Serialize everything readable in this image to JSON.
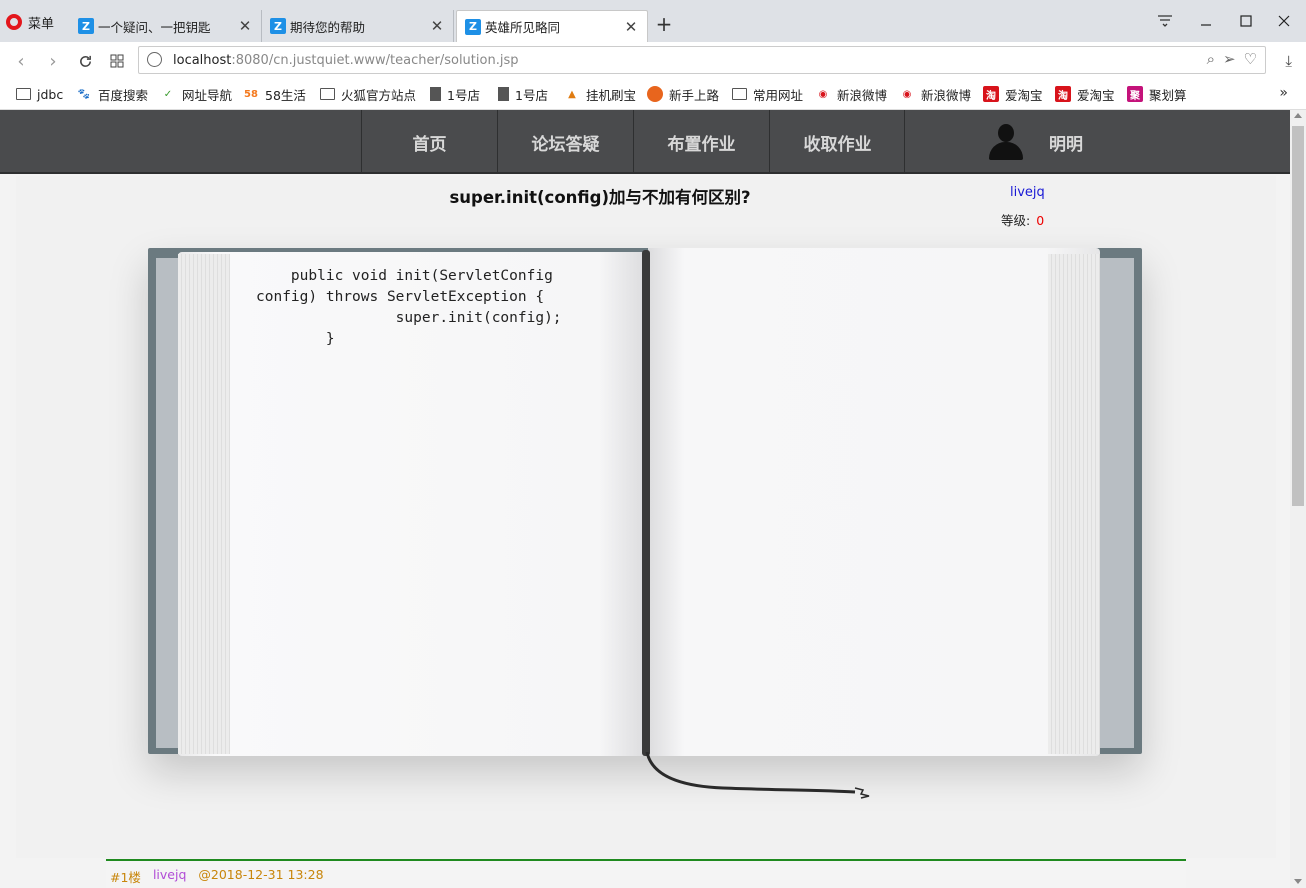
{
  "browser": {
    "menu_label": "菜单",
    "tabs": [
      {
        "title": "一个疑问、一把钥匙",
        "active": false
      },
      {
        "title": "期待您的帮助",
        "active": false
      },
      {
        "title": "英雄所见略同",
        "active": true
      }
    ],
    "new_tab": "+",
    "url_host": "localhost",
    "url_rest": ":8080/cn.justquiet.www/teacher/solution.jsp",
    "bookmarks": [
      {
        "label": "jdbc",
        "icon": "folder-icon"
      },
      {
        "label": "百度搜索",
        "icon": "baidu-icon"
      },
      {
        "label": "网址导航",
        "icon": "hao-icon"
      },
      {
        "label": "58生活",
        "icon": "58-icon"
      },
      {
        "label": "火狐官方站点",
        "icon": "folder-icon"
      },
      {
        "label": "1号店",
        "icon": "doc-icon"
      },
      {
        "label": "1号店",
        "icon": "doc-icon"
      },
      {
        "label": "挂机刷宝",
        "icon": "pma-icon"
      },
      {
        "label": "新手上路",
        "icon": "firefox-icon"
      },
      {
        "label": "常用网址",
        "icon": "folder-icon"
      },
      {
        "label": "新浪微博",
        "icon": "weibo-icon"
      },
      {
        "label": "新浪微博",
        "icon": "weibo-icon"
      },
      {
        "label": "爱淘宝",
        "icon": "taobao-icon"
      },
      {
        "label": "爱淘宝",
        "icon": "taobao-icon"
      },
      {
        "label": "聚划算",
        "icon": "juhuasuan-icon"
      }
    ]
  },
  "site": {
    "nav": [
      "首页",
      "论坛答疑",
      "布置作业",
      "收取作业"
    ],
    "username": "明明"
  },
  "question": {
    "title": "super.init(config)加与不加有何区别?",
    "author": "livejq",
    "level_label": "等级:",
    "level_value": "0",
    "code": "    public void init(ServletConfig\nconfig) throws ServletException {\n                super.init(config);\n        }"
  },
  "floor": {
    "number": "#1楼",
    "user": "livejq",
    "time": "@2018-12-31 13:28"
  },
  "colors": {
    "nav_bg": "#4a4b4d",
    "author_link": "#1a1ad6",
    "level_value": "#e00000",
    "floor_accent": "#1f8a1f"
  }
}
